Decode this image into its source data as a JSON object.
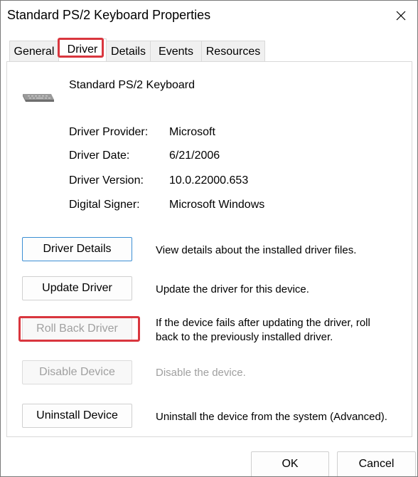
{
  "window": {
    "title": "Standard PS/2 Keyboard Properties",
    "close_icon": "close-icon"
  },
  "tabs": [
    {
      "label": "General",
      "active": false
    },
    {
      "label": "Driver",
      "active": true
    },
    {
      "label": "Details",
      "active": false
    },
    {
      "label": "Events",
      "active": false
    },
    {
      "label": "Resources",
      "active": false
    }
  ],
  "device": {
    "icon": "keyboard-icon",
    "name": "Standard PS/2 Keyboard"
  },
  "properties": [
    {
      "label": "Driver Provider:",
      "value": "Microsoft"
    },
    {
      "label": "Driver Date:",
      "value": "6/21/2006"
    },
    {
      "label": "Driver Version:",
      "value": "10.0.22000.653"
    },
    {
      "label": "Digital Signer:",
      "value": "Microsoft Windows"
    }
  ],
  "actions": [
    {
      "label": "Driver Details",
      "description": "View details about the installed driver files.",
      "enabled": true
    },
    {
      "label": "Update Driver",
      "description": "Update the driver for this device.",
      "enabled": true
    },
    {
      "label": "Roll Back Driver",
      "description_line1": "If the device fails after updating the driver, roll",
      "description_line2": "back to the previously installed driver.",
      "enabled": false
    },
    {
      "label": "Disable Device",
      "description": "Disable the device.",
      "enabled": false
    },
    {
      "label": "Uninstall Device",
      "description": "Uninstall the device from the system (Advanced).",
      "enabled": true
    }
  ],
  "footer": {
    "ok_label": "OK",
    "cancel_label": "Cancel"
  },
  "colors": {
    "highlight": "#d9363e",
    "focus_border": "#3c8fd4",
    "disabled_text": "#a0a0a0"
  }
}
